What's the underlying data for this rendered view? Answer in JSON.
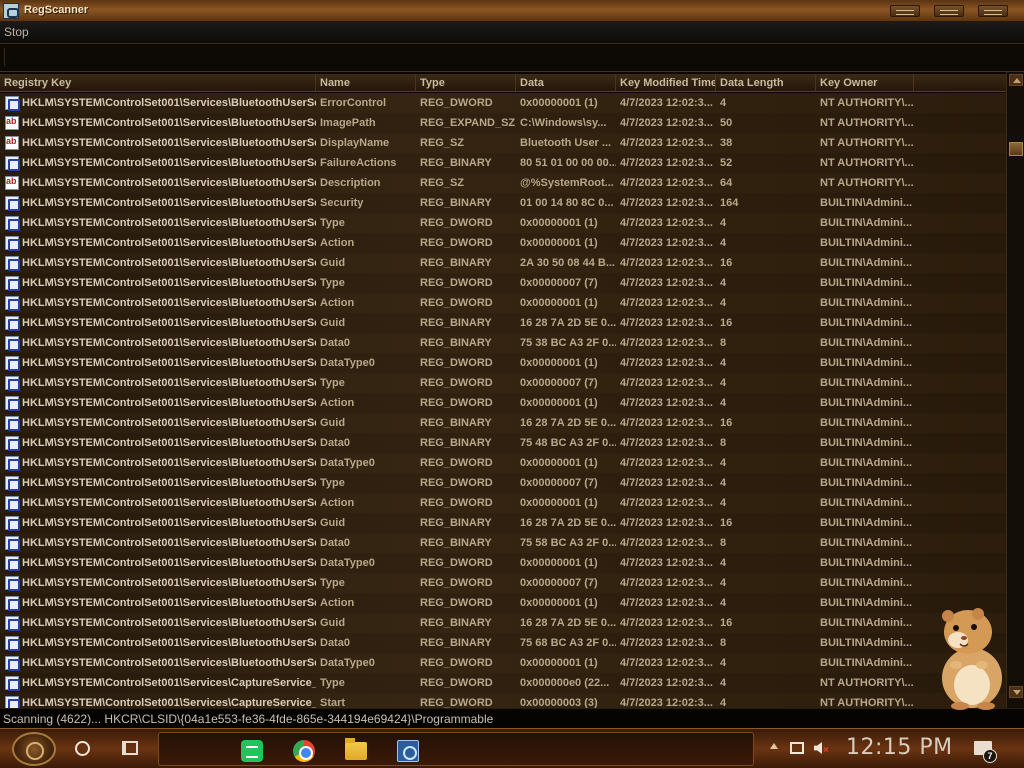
{
  "window": {
    "title": "RegScanner"
  },
  "toolbar": {
    "stop_label": "Stop"
  },
  "columns": [
    "Registry Key",
    "Name",
    "Type",
    "Data",
    "Key Modified Time",
    "Data Length",
    "Key Owner"
  ],
  "rows": [
    {
      "icon": "binary",
      "key": "HKLM\\SYSTEM\\ControlSet001\\Services\\BluetoothUserSe...",
      "name": "ErrorControl",
      "type": "REG_DWORD",
      "data": "0x00000001 (1)",
      "time": "4/7/2023 12:02:3...",
      "len": "4",
      "owner": "NT AUTHORITY\\..."
    },
    {
      "icon": "string",
      "key": "HKLM\\SYSTEM\\ControlSet001\\Services\\BluetoothUserSe...",
      "name": "ImagePath",
      "type": "REG_EXPAND_SZ",
      "data": "C:\\Windows\\sy...",
      "time": "4/7/2023 12:02:3...",
      "len": "50",
      "owner": "NT AUTHORITY\\..."
    },
    {
      "icon": "string",
      "key": "HKLM\\SYSTEM\\ControlSet001\\Services\\BluetoothUserSe...",
      "name": "DisplayName",
      "type": "REG_SZ",
      "data": "Bluetooth User ...",
      "time": "4/7/2023 12:02:3...",
      "len": "38",
      "owner": "NT AUTHORITY\\..."
    },
    {
      "icon": "binary",
      "key": "HKLM\\SYSTEM\\ControlSet001\\Services\\BluetoothUserSe...",
      "name": "FailureActions",
      "type": "REG_BINARY",
      "data": "80 51 01 00 00 00...",
      "time": "4/7/2023 12:02:3...",
      "len": "52",
      "owner": "NT AUTHORITY\\..."
    },
    {
      "icon": "string",
      "key": "HKLM\\SYSTEM\\ControlSet001\\Services\\BluetoothUserSe...",
      "name": "Description",
      "type": "REG_SZ",
      "data": "@%SystemRoot...",
      "time": "4/7/2023 12:02:3...",
      "len": "64",
      "owner": "NT AUTHORITY\\..."
    },
    {
      "icon": "binary",
      "key": "HKLM\\SYSTEM\\ControlSet001\\Services\\BluetoothUserSe...",
      "name": "Security",
      "type": "REG_BINARY",
      "data": "01 00 14 80 8C 0...",
      "time": "4/7/2023 12:02:3...",
      "len": "164",
      "owner": "BUILTIN\\Admini..."
    },
    {
      "icon": "binary",
      "key": "HKLM\\SYSTEM\\ControlSet001\\Services\\BluetoothUserSe...",
      "name": "Type",
      "type": "REG_DWORD",
      "data": "0x00000001 (1)",
      "time": "4/7/2023 12:02:3...",
      "len": "4",
      "owner": "BUILTIN\\Admini..."
    },
    {
      "icon": "binary",
      "key": "HKLM\\SYSTEM\\ControlSet001\\Services\\BluetoothUserSe...",
      "name": "Action",
      "type": "REG_DWORD",
      "data": "0x00000001 (1)",
      "time": "4/7/2023 12:02:3...",
      "len": "4",
      "owner": "BUILTIN\\Admini..."
    },
    {
      "icon": "binary",
      "key": "HKLM\\SYSTEM\\ControlSet001\\Services\\BluetoothUserSe...",
      "name": "Guid",
      "type": "REG_BINARY",
      "data": "2A 30 50 08 44 B...",
      "time": "4/7/2023 12:02:3...",
      "len": "16",
      "owner": "BUILTIN\\Admini..."
    },
    {
      "icon": "binary",
      "key": "HKLM\\SYSTEM\\ControlSet001\\Services\\BluetoothUserSe...",
      "name": "Type",
      "type": "REG_DWORD",
      "data": "0x00000007 (7)",
      "time": "4/7/2023 12:02:3...",
      "len": "4",
      "owner": "BUILTIN\\Admini..."
    },
    {
      "icon": "binary",
      "key": "HKLM\\SYSTEM\\ControlSet001\\Services\\BluetoothUserSe...",
      "name": "Action",
      "type": "REG_DWORD",
      "data": "0x00000001 (1)",
      "time": "4/7/2023 12:02:3...",
      "len": "4",
      "owner": "BUILTIN\\Admini..."
    },
    {
      "icon": "binary",
      "key": "HKLM\\SYSTEM\\ControlSet001\\Services\\BluetoothUserSe...",
      "name": "Guid",
      "type": "REG_BINARY",
      "data": "16 28 7A 2D 5E 0...",
      "time": "4/7/2023 12:02:3...",
      "len": "16",
      "owner": "BUILTIN\\Admini..."
    },
    {
      "icon": "binary",
      "key": "HKLM\\SYSTEM\\ControlSet001\\Services\\BluetoothUserSe...",
      "name": "Data0",
      "type": "REG_BINARY",
      "data": "75 38 BC A3 2F 0...",
      "time": "4/7/2023 12:02:3...",
      "len": "8",
      "owner": "BUILTIN\\Admini..."
    },
    {
      "icon": "binary",
      "key": "HKLM\\SYSTEM\\ControlSet001\\Services\\BluetoothUserSe...",
      "name": "DataType0",
      "type": "REG_DWORD",
      "data": "0x00000001 (1)",
      "time": "4/7/2023 12:02:3...",
      "len": "4",
      "owner": "BUILTIN\\Admini..."
    },
    {
      "icon": "binary",
      "key": "HKLM\\SYSTEM\\ControlSet001\\Services\\BluetoothUserSe...",
      "name": "Type",
      "type": "REG_DWORD",
      "data": "0x00000007 (7)",
      "time": "4/7/2023 12:02:3...",
      "len": "4",
      "owner": "BUILTIN\\Admini..."
    },
    {
      "icon": "binary",
      "key": "HKLM\\SYSTEM\\ControlSet001\\Services\\BluetoothUserSe...",
      "name": "Action",
      "type": "REG_DWORD",
      "data": "0x00000001 (1)",
      "time": "4/7/2023 12:02:3...",
      "len": "4",
      "owner": "BUILTIN\\Admini..."
    },
    {
      "icon": "binary",
      "key": "HKLM\\SYSTEM\\ControlSet001\\Services\\BluetoothUserSe...",
      "name": "Guid",
      "type": "REG_BINARY",
      "data": "16 28 7A 2D 5E 0...",
      "time": "4/7/2023 12:02:3...",
      "len": "16",
      "owner": "BUILTIN\\Admini..."
    },
    {
      "icon": "binary",
      "key": "HKLM\\SYSTEM\\ControlSet001\\Services\\BluetoothUserSe...",
      "name": "Data0",
      "type": "REG_BINARY",
      "data": "75 48 BC A3 2F 0...",
      "time": "4/7/2023 12:02:3...",
      "len": "8",
      "owner": "BUILTIN\\Admini..."
    },
    {
      "icon": "binary",
      "key": "HKLM\\SYSTEM\\ControlSet001\\Services\\BluetoothUserSe...",
      "name": "DataType0",
      "type": "REG_DWORD",
      "data": "0x00000001 (1)",
      "time": "4/7/2023 12:02:3...",
      "len": "4",
      "owner": "BUILTIN\\Admini..."
    },
    {
      "icon": "binary",
      "key": "HKLM\\SYSTEM\\ControlSet001\\Services\\BluetoothUserSe...",
      "name": "Type",
      "type": "REG_DWORD",
      "data": "0x00000007 (7)",
      "time": "4/7/2023 12:02:3...",
      "len": "4",
      "owner": "BUILTIN\\Admini..."
    },
    {
      "icon": "binary",
      "key": "HKLM\\SYSTEM\\ControlSet001\\Services\\BluetoothUserSe...",
      "name": "Action",
      "type": "REG_DWORD",
      "data": "0x00000001 (1)",
      "time": "4/7/2023 12:02:3...",
      "len": "4",
      "owner": "BUILTIN\\Admini..."
    },
    {
      "icon": "binary",
      "key": "HKLM\\SYSTEM\\ControlSet001\\Services\\BluetoothUserSe...",
      "name": "Guid",
      "type": "REG_BINARY",
      "data": "16 28 7A 2D 5E 0...",
      "time": "4/7/2023 12:02:3...",
      "len": "16",
      "owner": "BUILTIN\\Admini..."
    },
    {
      "icon": "binary",
      "key": "HKLM\\SYSTEM\\ControlSet001\\Services\\BluetoothUserSe...",
      "name": "Data0",
      "type": "REG_BINARY",
      "data": "75 58 BC A3 2F 0...",
      "time": "4/7/2023 12:02:3...",
      "len": "8",
      "owner": "BUILTIN\\Admini..."
    },
    {
      "icon": "binary",
      "key": "HKLM\\SYSTEM\\ControlSet001\\Services\\BluetoothUserSe...",
      "name": "DataType0",
      "type": "REG_DWORD",
      "data": "0x00000001 (1)",
      "time": "4/7/2023 12:02:3...",
      "len": "4",
      "owner": "BUILTIN\\Admini..."
    },
    {
      "icon": "binary",
      "key": "HKLM\\SYSTEM\\ControlSet001\\Services\\BluetoothUserSe...",
      "name": "Type",
      "type": "REG_DWORD",
      "data": "0x00000007 (7)",
      "time": "4/7/2023 12:02:3...",
      "len": "4",
      "owner": "BUILTIN\\Admini..."
    },
    {
      "icon": "binary",
      "key": "HKLM\\SYSTEM\\ControlSet001\\Services\\BluetoothUserSe...",
      "name": "Action",
      "type": "REG_DWORD",
      "data": "0x00000001 (1)",
      "time": "4/7/2023 12:02:3...",
      "len": "4",
      "owner": "BUILTIN\\Admini..."
    },
    {
      "icon": "binary",
      "key": "HKLM\\SYSTEM\\ControlSet001\\Services\\BluetoothUserSe...",
      "name": "Guid",
      "type": "REG_BINARY",
      "data": "16 28 7A 2D 5E 0...",
      "time": "4/7/2023 12:02:3...",
      "len": "16",
      "owner": "BUILTIN\\Admini..."
    },
    {
      "icon": "binary",
      "key": "HKLM\\SYSTEM\\ControlSet001\\Services\\BluetoothUserSe...",
      "name": "Data0",
      "type": "REG_BINARY",
      "data": "75 68 BC A3 2F 0...",
      "time": "4/7/2023 12:02:3...",
      "len": "8",
      "owner": "BUILTIN\\Admini..."
    },
    {
      "icon": "binary",
      "key": "HKLM\\SYSTEM\\ControlSet001\\Services\\BluetoothUserSe...",
      "name": "DataType0",
      "type": "REG_DWORD",
      "data": "0x00000001 (1)",
      "time": "4/7/2023 12:02:3...",
      "len": "4",
      "owner": "BUILTIN\\Admini..."
    },
    {
      "icon": "binary",
      "key": "HKLM\\SYSTEM\\ControlSet001\\Services\\CaptureService_...",
      "name": "Type",
      "type": "REG_DWORD",
      "data": "0x000000e0 (22...",
      "time": "4/7/2023 12:02:3...",
      "len": "4",
      "owner": "NT AUTHORITY\\..."
    },
    {
      "icon": "binary",
      "key": "HKLM\\SYSTEM\\ControlSet001\\Services\\CaptureService_...",
      "name": "Start",
      "type": "REG_DWORD",
      "data": "0x00000003 (3)",
      "time": "4/7/2023 12:02:3...",
      "len": "4",
      "owner": "NT AUTHORITY\\..."
    }
  ],
  "status": {
    "text": "Scanning (4622)... HKCR\\CLSID\\{04a1e553-fe36-4fde-865e-344194e69424}\\Programmable"
  },
  "taskbar": {
    "clock": "12:15 PM",
    "notification_count": "7",
    "apps": [
      "notes-icon",
      "chrome-icon",
      "file-explorer-icon",
      "regscanner-icon"
    ]
  },
  "colors": {
    "accent": "#8b5523",
    "row_text": "#b8a78b",
    "key_text": "#d9cdb7"
  }
}
